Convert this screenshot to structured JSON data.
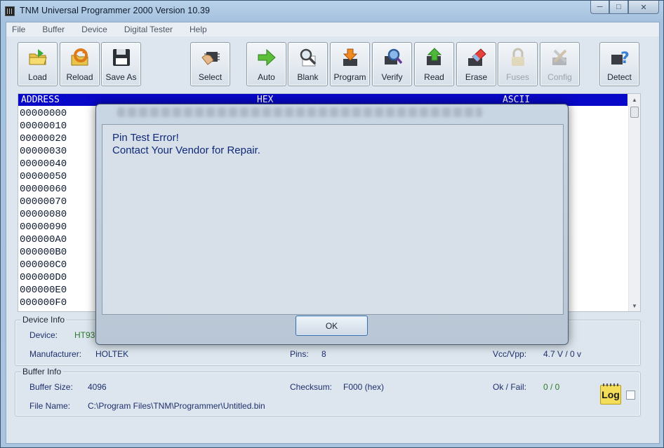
{
  "window": {
    "title": "TNM  Universal Programmer 2000   Version 10.39"
  },
  "menu": [
    "File",
    "Buffer",
    "Device",
    "Digital Tester",
    "Help"
  ],
  "toolbar": [
    {
      "label": "Load",
      "icon": "load-folder-icon",
      "enabled": true
    },
    {
      "label": "Reload",
      "icon": "reload-icon",
      "enabled": true
    },
    {
      "label": "Save As",
      "icon": "floppy-disk-icon",
      "enabled": true
    },
    {
      "label": "Select",
      "icon": "select-chip-icon",
      "enabled": true
    },
    {
      "label": "Auto",
      "icon": "auto-arrow-icon",
      "enabled": true
    },
    {
      "label": "Blank",
      "icon": "blank-check-icon",
      "enabled": true
    },
    {
      "label": "Program",
      "icon": "program-icon",
      "enabled": true
    },
    {
      "label": "Verify",
      "icon": "verify-icon",
      "enabled": true
    },
    {
      "label": "Read",
      "icon": "read-icon",
      "enabled": true
    },
    {
      "label": "Erase",
      "icon": "eraser-icon",
      "enabled": true
    },
    {
      "label": "Fuses",
      "icon": "lock-icon",
      "enabled": false
    },
    {
      "label": "Config",
      "icon": "config-tools-icon",
      "enabled": false
    },
    {
      "label": "Detect",
      "icon": "detect-chip-icon",
      "enabled": true
    }
  ],
  "hex": {
    "headers": {
      "address": "ADDRESS",
      "hex": "HEX",
      "ascii": "ASCII"
    },
    "addresses": [
      "00000000",
      "00000010",
      "00000020",
      "00000030",
      "00000040",
      "00000050",
      "00000060",
      "00000070",
      "00000080",
      "00000090",
      "000000A0",
      "000000B0",
      "000000C0",
      "000000D0",
      "000000E0",
      "000000F0"
    ]
  },
  "device_info": {
    "title": "Device Info",
    "device_label": "Device:",
    "device_value": "HT93",
    "manufacturer_label": "Manufacturer:",
    "manufacturer_value": "HOLTEK",
    "pins_label": "Pins:",
    "pins_value": "8",
    "vcc_label": "Vcc/Vpp:",
    "vcc_value": "4.7 V / 0 v"
  },
  "buffer_info": {
    "title": "Buffer Info",
    "size_label": "Buffer Size:",
    "size_value": "4096",
    "checksum_label": "Checksum:",
    "checksum_value": "F000 (hex)",
    "okfail_label": "Ok / Fail:",
    "okfail_value": "0 / 0",
    "filename_label": "File Name:",
    "filename_value": "C:\\Program Files\\TNM\\Programmer\\Untitled.bin",
    "log_label": "Log"
  },
  "dialog": {
    "line1": "Pin Test Error!",
    "line2": "Contact Your Vendor for Repair.",
    "ok": "OK"
  },
  "colors": {
    "accent_header": "#0808c8",
    "message_text": "#102a7a",
    "value_green": "#2a7a2a"
  }
}
